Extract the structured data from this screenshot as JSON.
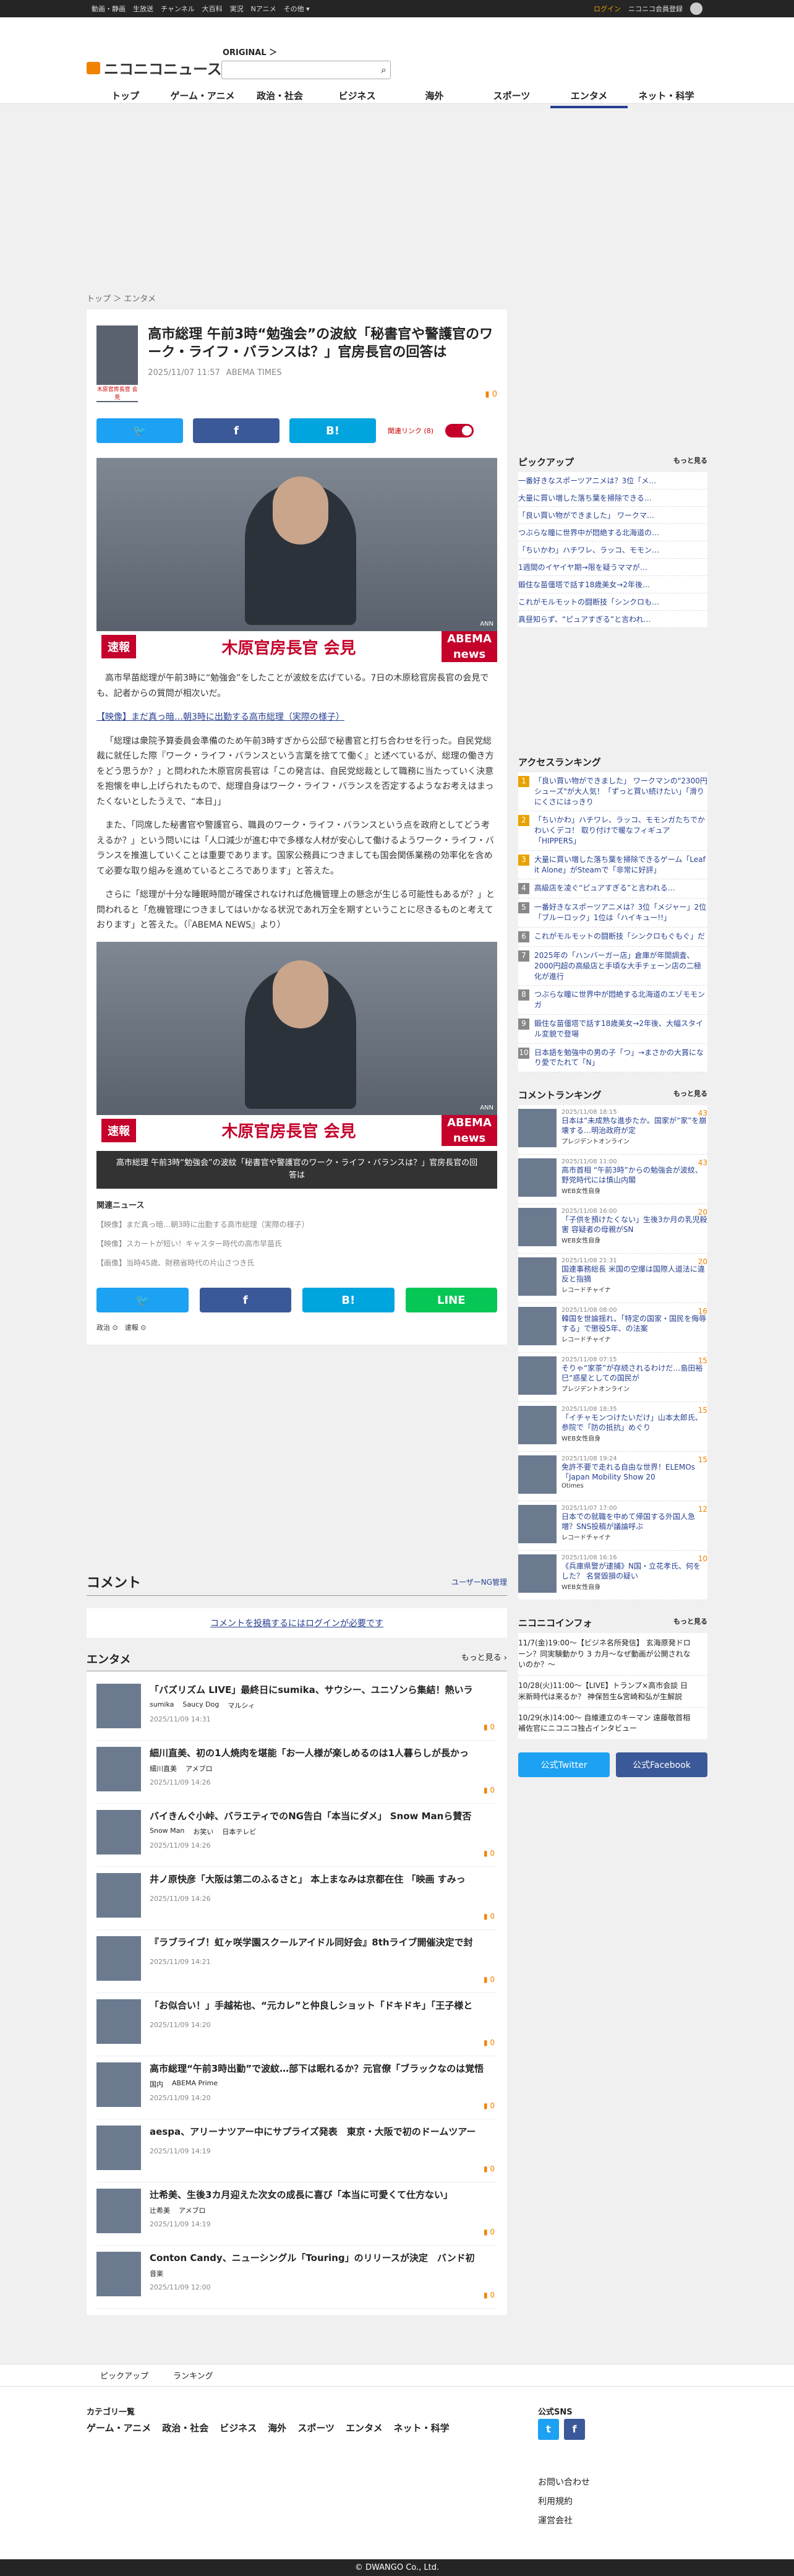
{
  "topbar": {
    "items": [
      "動画・静画",
      "生放送",
      "チャンネル",
      "大百科",
      "実況",
      "Nアニメ",
      "その他 ▾"
    ],
    "login": "ログイン",
    "premium": "ニコニコ会員登録"
  },
  "header": {
    "logo": "ニコニコニュース",
    "original": "ORIGINAL ＞",
    "nav": [
      "トップ",
      "ゲーム・アニメ",
      "政治・社会",
      "ビジネス",
      "海外",
      "スポーツ",
      "エンタメ",
      "ネット・科学"
    ]
  },
  "breadcrumb": "トップ ＞ エンタメ",
  "article": {
    "title": "高市総理 午前3時“勉強会”の波紋「秘書官や警護官のワーク・ライフ・バランスは？」官房長官の回答は",
    "date": "2025/11/07 11:57",
    "source": "ABEMA TIMES",
    "comments": "0",
    "thumb_caption": "木原官房長官 会見",
    "related_link": "関連リンク (8)",
    "photo_tag": "速報",
    "photo_caption": "木原官房長官 会見",
    "abema": "ABEMA news",
    "ann": "ANN",
    "lead": "高市早苗総理が午前3時に“勉強会”をしたことが波紋を広げている。7日の木原稔官房長官の会見でも、記者からの質問が相次いだ。",
    "video_link": "【映像】まだ真っ暗…朝3時に出勤する高市総理（実際の様子）",
    "p1": "「総理は衆院予算委員会準備のため午前3時すぎから公邸で秘書官と打ち合わせを行った。自民党総裁に就任した際『ワーク・ライフ・バランスという言葉を捨てて働く』と述べているが、総理の働き方をどう思うか？」と問われた木原官房長官は「この発言は、自民党総裁として職務に当たっていく決意を抱懐を申し上げられたもので、総理自身はワーク・ライフ・バランスを否定するようなお考えはまったくないとしたうえで、“本日」」",
    "p2": "また、「同席した秘書官や警護官ら、職員のワーク・ライフ・バランスという点を政府としてどう考えるか？」という問いには「人口減少が進む中で多様な人材が安心して働けるようワーク・ライフ・バランスを推進していくことは重要であります。国家公務員につきましても国会関係業務の効率化を含めて必要な取り組みを進めているところであります」と答えた。",
    "p3": "さらに「総理が十分な睡眠時間が確保されなければ危機管理上の懸念が生じる可能性もあるが？」と問われると「危機管理につきましてはいかなる状況であれ万全を期すということに尽きるものと考えております」と答えた。（『ABEMA NEWS』より）",
    "caption2": "高市総理 午前3時“勉強会”の波紋「秘書官や警護官のワーク・ライフ・バランスは？」官房長官の回答は",
    "related_title": "関連ニュース",
    "related": [
      "【映像】まだ真っ暗…朝3時に出勤する高市総理（実際の様子）",
      "【映像】スカートが短い！キャスター時代の高市早苗氏",
      "【画像】当時45歳、財務省時代の片山さつき氏"
    ],
    "tags": [
      "政治",
      "速報"
    ]
  },
  "comment": {
    "title": "コメント",
    "guide": "ユーザーNG管理",
    "login": "コメントを投稿するにはログインが必要です"
  },
  "entame": {
    "title": "エンタメ",
    "more": "もっと見る ›",
    "items": [
      {
        "t": "「バズリズム LIVE」最終日にsumika、サウシー、ユニゾンら集結！熱いラ",
        "tags": [
          "sumika",
          "Saucy Dog",
          "マルシィ"
        ],
        "d": "2025/11/09 14:31"
      },
      {
        "t": "細川直美、初の1人焼肉を堪能「お一人様が楽しめるのは1人暮らしが長かっ",
        "tags": [
          "細川直美",
          "アメブロ"
        ],
        "d": "2025/11/09 14:26"
      },
      {
        "t": "バイきんぐ小峠、バラエティでのNG告白「本当にダメ」 Snow Manら賛否",
        "tags": [
          "Snow Man",
          "お笑い",
          "日本テレビ"
        ],
        "d": "2025/11/09 14:26"
      },
      {
        "t": "井ノ原快彦「大阪は第二のふるさと」 本上まなみは京都在住 「映画 すみっ",
        "tags": [],
        "d": "2025/11/09 14:26"
      },
      {
        "t": "『ラブライブ！虹ヶ咲学園スクールアイドル同好会』8thライブ開催決定で封",
        "tags": [],
        "d": "2025/11/09 14:21"
      },
      {
        "t": "「お似合い！」手越祐也、“元カレ”と仲良しショット「ドキドキ」「王子様と",
        "tags": [],
        "d": "2025/11/09 14:20"
      },
      {
        "t": "高市総理“午前3時出勤”で波紋…部下は眠れるか？元官僚「ブラックなのは覚悟",
        "tags": [
          "国内",
          "ABEMA Prime"
        ],
        "d": "2025/11/09 14:20"
      },
      {
        "t": "aespa、アリーナツアー中にサプライズ発表　東京・大阪で初のドームツアー",
        "tags": [],
        "d": "2025/11/09 14:19"
      },
      {
        "t": "辻希美、生後3カ月迎えた次女の成長に喜び「本当に可愛くて仕方ない」",
        "tags": [
          "辻希美",
          "アメブロ"
        ],
        "d": "2025/11/09 14:19"
      },
      {
        "t": "Conton Candy、ニューシングル「Touring」のリリースが決定　バンド初",
        "tags": [
          "音楽"
        ],
        "d": "2025/11/09 12:00"
      }
    ]
  },
  "side": {
    "pickup_title": "ピックアップ",
    "more": "もっと見る",
    "pickup": [
      "一番好きなスポーツアニメは？3位「メ…",
      "大量に買い増した落ち葉を掃除できる…",
      "「良い買い物ができました」 ワークマ…",
      "つぶらな瞳に世界中が悶絶する北海道の…",
      "「ちいかわ」ハチワレ、ラッコ、モモン…",
      "1週間のイヤイヤ期→限を疑うママが…",
      "鍛住な苗僵塔で話す18歳美女→2年後…",
      "これがモルモットの闘断技「シンクロも…",
      "真昼知らず、“ピュアすぎる”と言われ…"
    ],
    "access_title": "アクセスランキング",
    "access": [
      "「良い買い物ができました」 ワークマンの\"2300円シューズ\"が大人気！「ずっと買い続けたい」「滑りにくさにはっきり",
      "「ちいかわ」ハチワレ、ラッコ、モモンガたちでかわいくデコ！ 取り付けで暖なフィギュア「HIPPERS」",
      "大量に買い増した落ち葉を掃除できるゲーム「Leaf it Alone」がSteamで「非常に好評」",
      "高級店を凌ぐ“ピュアすぎる”と言われる…",
      "一番好きなスポーツアニメは？3位「メジャー」2位「ブルーロック」1位は「ハイキュー!!」",
      "これがモルモットの闘断技「シンクロもぐもぐ」だ",
      "2025年の「ハンバーガー店」倉庫が年間調査、2000円超の高級店と手頃な大手チェーン店の二極化が進行",
      "つぶらな瞳に世界中が悶絶する北海道のエゾモモンガ",
      "鍛住な苗僵塔で話す18歳美女→2年後、大幅スタイル変貌で登場",
      "日本語を勉強中の男の子「つ」→まさかの大賞になり愛でたれて「N」"
    ],
    "crank_title": "コメントランキング",
    "crank": [
      {
        "dt": "2025/11/08 18:15",
        "tt": "日本は“未成熟な進歩たか。国家が“家”を崩壊する…明治政府が定",
        "src": "プレジデントオンライン",
        "cc": "43"
      },
      {
        "dt": "2025/11/08 11:00",
        "tt": "高市首相 “午前3時”からの勉強会が波紋、野党時代には慎山内閣",
        "src": "WEB女性自身",
        "cc": "43"
      },
      {
        "dt": "2025/11/08 16:00",
        "tt": "「子供を預けたくない」生後3か月の乳児殺害 容疑者の母親がSN",
        "src": "WEB女性自身",
        "cc": "20"
      },
      {
        "dt": "2025/11/08 21:31",
        "tt": "国連事務総長 米国の空爆は国際人道法に違反と指摘",
        "src": "レコードチャイナ",
        "cc": "20"
      },
      {
        "dt": "2025/11/08 08:00",
        "tt": "韓国を世論揺れ、「特定の国家・国民を侮辱する」で懲役5年、の法案",
        "src": "レコードチャイナ",
        "cc": "16"
      },
      {
        "dt": "2025/11/08 07:15",
        "tt": "そりゃ“家茶”が存続されるわけだ…島田裕巳“惑星としての国民が",
        "src": "プレジデントオンライン",
        "cc": "15"
      },
      {
        "dt": "2025/11/08 18:35",
        "tt": "「イチャモンつけたいだけ」山本太郎氏、参院で「防の抵抗」めぐり",
        "src": "WEB女性自身",
        "cc": "15"
      },
      {
        "dt": "2025/11/08 19:24",
        "tt": "免許不要で走れる自由な世界！ELEMOs「Japan Mobility Show 20",
        "src": "Otimes",
        "cc": "15"
      },
      {
        "dt": "2025/11/07 17:00",
        "tt": "日本での就職を中めて帰国する外国人急増？SNS投稿が議論呼ぶ",
        "src": "レコードチャイナ",
        "cc": "12"
      },
      {
        "dt": "2025/11/08 16:16",
        "tt": "《兵庫県警が逮捕》N国・立花孝氏、何をした？ 名誉毀損の疑い",
        "src": "WEB女性自身",
        "cc": "10"
      }
    ],
    "info_title": "ニコニコインフォ",
    "info": [
      "11/7(金)19:00〜【ビジネ名所発信】 玄海原発ドローン？同実験動かり 3 カ月〜なぜ動画が公開されないのか？〜",
      "10/28(火)11:00〜【LIVE】トランプ×高市会談 日米新時代は来るか？ 神保哲生&宮崎和弘が生解説",
      "10/29(水)14:00〜 自維連立のキーマン 遠藤敬首相補佐官にニコニコ独占インタビュー"
    ],
    "tw": "公式Twitter",
    "fb": "公式Facebook"
  },
  "footer": {
    "links": [
      "ピックアップ",
      "ランキング"
    ],
    "cat_title": "カテゴリ一覧",
    "cats": [
      "ゲーム・アニメ",
      "政治・社会",
      "ビジネス",
      "海外",
      "スポーツ",
      "エンタメ",
      "ネット・科学"
    ],
    "sns_title": "公式SNS",
    "corp": [
      "お問い合わせ",
      "利用規約",
      "運営会社"
    ],
    "copy": "© DWANGO Co., Ltd."
  }
}
